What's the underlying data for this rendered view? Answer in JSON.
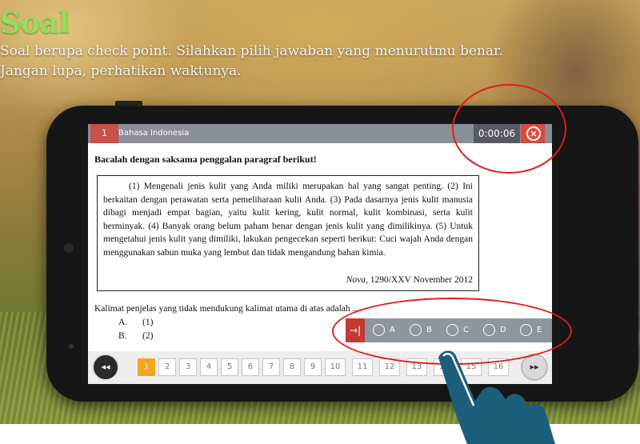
{
  "header": {
    "title": "Soal",
    "subtitle_line1": "Soal berupa check point. Silahkan pilih jawaban yang menurutmu benar.",
    "subtitle_line2": "Jangan lupa, perhatikan waktunya."
  },
  "quiz": {
    "question_number": "1",
    "subject": "Bahasa Indonesia",
    "timer": "0:00:06",
    "instruction": "Bacalah dengan saksama penggalan paragraf berikut!",
    "passage": "(1) Mengenali jenis kulit yang Anda miliki merupakan hal yang sangat penting. (2) Ini berkaitan dengan perawatan serta pemeliharaan kulit Anda. (3) Pada dasarnya jenis kulit manusia dibagi menjadi empat bagian, yaitu kulit kering, kulit normal, kulit kombinasi, serta kulit berminyak. (4) Banyak orang belum paham benar dengan jenis kulit yang dimilikinya. (5) Untuk mengetahui jenis kulit yang dimiliki, lakukan pengecekan seperti berikut: Cuci wajah Anda dengan menggunakan sabun muka yang lembut dan tidak mengandung bahan kimia.",
    "citation_source": "Nova,",
    "citation_detail": " 1290/XXV November 2012",
    "question": "Kalimat penjelas yang tidak mendukung kalimat utama di atas adalah ....",
    "choices": [
      {
        "letter": "A.",
        "text": "(1)"
      },
      {
        "letter": "B.",
        "text": "(2)"
      }
    ],
    "answer_options": [
      "A",
      "B",
      "C",
      "D",
      "E"
    ],
    "toggle_icon": "collapse-arrow-icon"
  },
  "pager": {
    "prev_label": "◂◂",
    "next_label": "▸▸",
    "pages": [
      "1",
      "2",
      "3",
      "4",
      "5",
      "6",
      "7",
      "8",
      "9",
      "10",
      "11",
      "12",
      "13",
      "14",
      "15",
      "16"
    ],
    "active_page": "1"
  },
  "colors": {
    "title_green": "#8fe05a",
    "accent_red": "#c9514a",
    "active_page": "#f4a61c",
    "highlight_circle": "#e31c1c",
    "hand": "#1b5f7a"
  }
}
